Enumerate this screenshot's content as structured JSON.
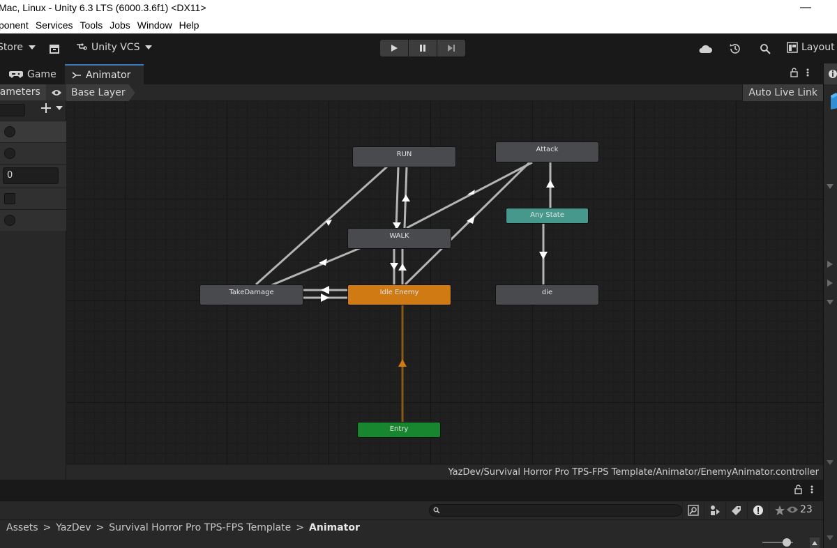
{
  "window": {
    "title": "Mac, Linux - Unity 6.3 LTS (6000.3.6f1) <DX11>",
    "minimize_glyph": "—"
  },
  "menu": [
    "ponent",
    "Services",
    "Tools",
    "Jobs",
    "Window",
    "Help"
  ],
  "toolbar": {
    "store_label": "Store",
    "vcs_label": "Unity VCS",
    "layout_label": "Layout"
  },
  "tabs": [
    {
      "label": "Game",
      "icon": "gamepad-icon"
    },
    {
      "label": "Animator",
      "icon": "animator-icon",
      "active": true
    }
  ],
  "parameters": {
    "header": "rameters",
    "rows": [
      {
        "type": "trigger"
      },
      {
        "type": "trigger"
      },
      {
        "type": "int",
        "value": "0"
      },
      {
        "type": "bool"
      },
      {
        "type": "trigger"
      }
    ]
  },
  "animator": {
    "layer": "Base Layer",
    "auto_live_link": "Auto Live Link",
    "path": "YazDev/Survival Horror Pro TPS-FPS Template/Animator/EnemyAnimator.controller",
    "states": {
      "run": "RUN",
      "attack": "Attack",
      "walk": "WALK",
      "any_state": "Any State",
      "take_damage": "TakeDamage",
      "idle_enemy": "Idle Enemy",
      "die": "die",
      "entry": "Entry"
    }
  },
  "project": {
    "breadcrumbs": [
      "Assets",
      "YazDev",
      "Survival Horror Pro TPS-FPS Template",
      "Animator"
    ],
    "hidden_count": "23"
  },
  "colors": {
    "accent_tab": "#3a79bb",
    "node_gray": "#494a4e",
    "node_orange": "#d07a14",
    "node_teal": "#45988b",
    "node_green": "#17862f",
    "default_transition": "#d07a14"
  }
}
